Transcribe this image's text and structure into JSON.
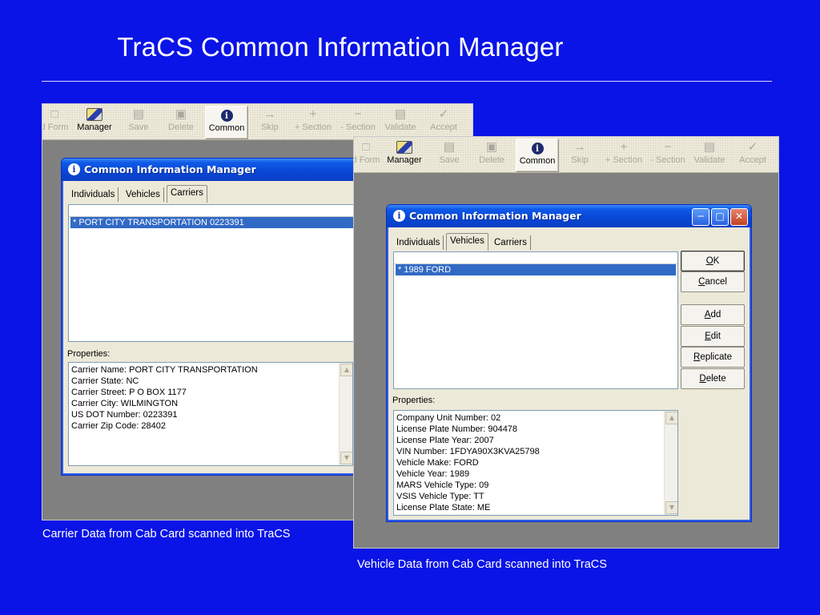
{
  "slide": {
    "title": "TraCS Common Information Manager",
    "caption_left": "Carrier Data from Cab Card scanned into TraCS",
    "caption_right": "Vehicle Data from Cab Card scanned into TraCS"
  },
  "toolbar_left": [
    {
      "label": "d Form",
      "icon": "form-icon",
      "enabled": false
    },
    {
      "label": "Manager",
      "icon": "manager-icon",
      "enabled": true
    },
    {
      "label": "Save",
      "icon": "save-icon",
      "enabled": false
    },
    {
      "label": "Delete",
      "icon": "delete-icon",
      "enabled": false
    },
    {
      "label": "Common",
      "icon": "info-icon",
      "enabled": true,
      "pressed": true
    },
    {
      "label": "Skip",
      "icon": "arrow-right-icon",
      "enabled": false
    },
    {
      "label": "+ Section",
      "icon": "plus-icon",
      "enabled": false
    },
    {
      "label": "- Section",
      "icon": "minus-icon",
      "enabled": false
    },
    {
      "label": "Validate",
      "icon": "validate-icon",
      "enabled": false
    },
    {
      "label": "Accept",
      "icon": "check-icon",
      "enabled": false
    }
  ],
  "toolbar_right": [
    {
      "label": "d Form",
      "icon": "form-icon",
      "enabled": false
    },
    {
      "label": "Manager",
      "icon": "manager-icon",
      "enabled": true
    },
    {
      "label": "Save",
      "icon": "save-icon",
      "enabled": false
    },
    {
      "label": "Delete",
      "icon": "delete-icon",
      "enabled": false
    },
    {
      "label": "Common",
      "icon": "info-icon",
      "enabled": true,
      "pressed": true
    },
    {
      "label": "Skip",
      "icon": "arrow-right-icon",
      "enabled": false
    },
    {
      "label": "+ Section",
      "icon": "plus-icon",
      "enabled": false
    },
    {
      "label": "- Section",
      "icon": "minus-icon",
      "enabled": false
    },
    {
      "label": "Validate",
      "icon": "validate-icon",
      "enabled": false
    },
    {
      "label": "Accept",
      "icon": "check-icon",
      "enabled": false
    }
  ],
  "left_dialog": {
    "title": "Common Information Manager",
    "tabs": [
      "Individuals",
      "Vehicles",
      "Carriers"
    ],
    "active_tab": "Carriers",
    "list_items": [
      "* PORT CITY TRANSPORTATION  0223391"
    ],
    "properties_label": "Properties:",
    "properties": [
      "Carrier Name:  PORT CITY TRANSPORTATION",
      "Carrier State:  NC",
      "Carrier Street:  P O BOX 1177",
      "Carrier City:  WILMINGTON",
      "US DOT Number:  0223391",
      "Carrier Zip Code:  28402"
    ]
  },
  "right_dialog": {
    "title": "Common Information Manager",
    "tabs": [
      "Individuals",
      "Vehicles",
      "Carriers"
    ],
    "active_tab": "Vehicles",
    "list_items": [
      "* 1989  FORD"
    ],
    "properties_label": "Properties:",
    "properties": [
      "Company Unit Number:  02",
      "License Plate Number:  904478",
      "License Plate Year:  2007",
      "VIN Number:  1FDYA90X3KVA25798",
      "Vehicle Make:  FORD",
      "Vehicle Year:  1989",
      "MARS Vehicle Type:  09",
      "VSIS Vehicle Type:  TT",
      "License Plate State:  ME"
    ],
    "buttons": {
      "ok": {
        "mnemonic": "O",
        "rest": "K"
      },
      "cancel": {
        "mnemonic": "C",
        "rest": "ancel"
      },
      "add": {
        "mnemonic": "A",
        "rest": "dd"
      },
      "edit": {
        "mnemonic": "E",
        "rest": "dit"
      },
      "replicate": {
        "mnemonic": "R",
        "rest": "eplicate"
      },
      "delete": {
        "mnemonic": "D",
        "rest": "elete"
      }
    }
  },
  "colors": {
    "slide_bg": "#0a14e6",
    "selection": "#316ac5",
    "titlebar": "#0846d4"
  }
}
